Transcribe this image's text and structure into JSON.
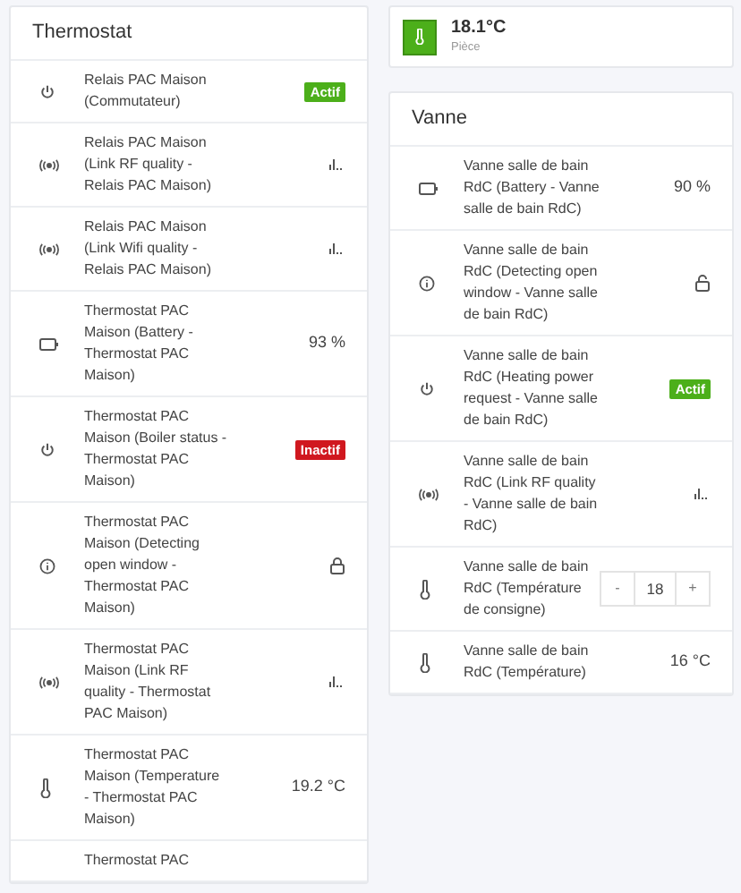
{
  "thermostat": {
    "title": "Thermostat",
    "rows": [
      {
        "kind": "power",
        "label": "Relais PAC Maison (Commutateur)",
        "badge": "Actif",
        "active": true
      },
      {
        "kind": "signal",
        "label": "Relais PAC Maison (Link RF quality - Relais PAC Maison)"
      },
      {
        "kind": "signal",
        "label": "Relais PAC Maison (Link Wifi quality - Relais PAC Maison)"
      },
      {
        "kind": "battery",
        "label": "Thermostat PAC Maison (Battery - Thermostat PAC Maison)",
        "value": "93 %"
      },
      {
        "kind": "power",
        "label": "Thermostat PAC Maison (Boiler status - Thermostat PAC Maison)",
        "badge": "Inactif",
        "active": false
      },
      {
        "kind": "info",
        "label": "Thermostat PAC Maison (Detecting open window - Thermostat PAC Maison)",
        "locked": true
      },
      {
        "kind": "signal",
        "label": "Thermostat PAC Maison (Link RF quality - Thermostat PAC Maison)"
      },
      {
        "kind": "thermometer",
        "label": "Thermostat PAC Maison (Temperature - Thermostat PAC Maison)",
        "value": "19.2 °C"
      },
      {
        "label": "Thermostat PAC"
      }
    ]
  },
  "room": {
    "temperature": "18.1°C",
    "name": "Pièce"
  },
  "vanne": {
    "title": "Vanne",
    "rows": [
      {
        "kind": "battery",
        "label": "Vanne salle de bain RdC (Battery - Vanne salle de bain RdC)",
        "value": "90 %"
      },
      {
        "kind": "info",
        "label": "Vanne salle de bain RdC (Detecting open window - Vanne salle de bain RdC)",
        "locked": false
      },
      {
        "kind": "power",
        "label": "Vanne salle de bain RdC (Heating power request - Vanne salle de bain RdC)",
        "badge": "Actif",
        "active": true
      },
      {
        "kind": "signal",
        "label": "Vanne salle de bain RdC (Link RF quality - Vanne salle de bain RdC)"
      },
      {
        "kind": "thermometer",
        "label": "Vanne salle de bain RdC (Température de consigne)",
        "stepper": {
          "minus": "-",
          "value": "18",
          "plus": "+"
        }
      },
      {
        "kind": "thermometer",
        "label": "Vanne salle de bain RdC (Température)",
        "value": "16 °C"
      }
    ]
  }
}
